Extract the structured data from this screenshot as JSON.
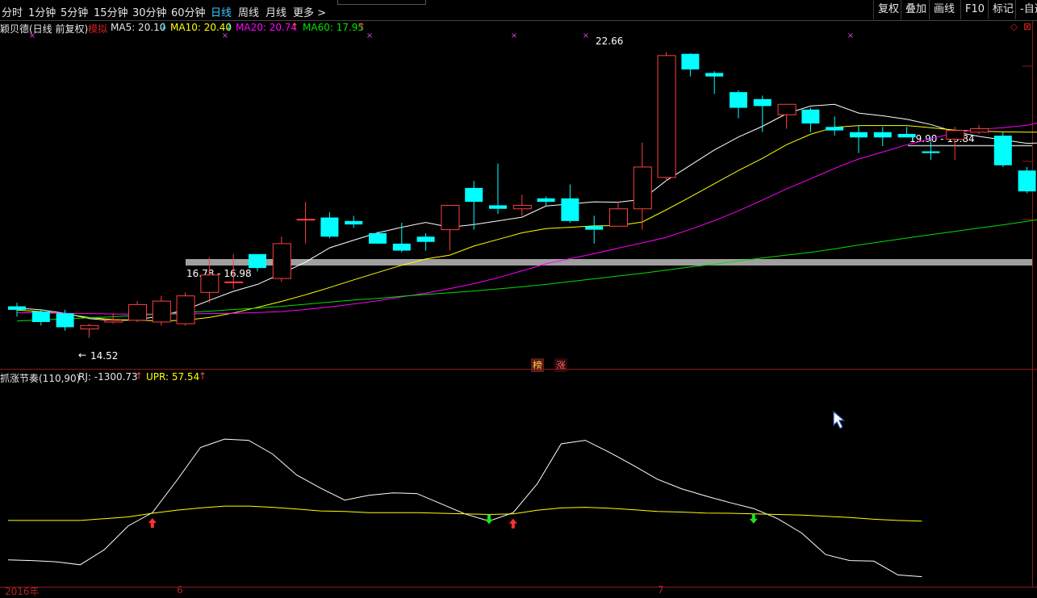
{
  "toolbar": {
    "timeframes": [
      "分时",
      "1分钟",
      "5分钟",
      "15分钟",
      "30分钟",
      "60分钟",
      "日线",
      "周线",
      "月线",
      "更多 >"
    ],
    "active": "日线",
    "right_buttons": [
      "复权",
      "叠加",
      "画线",
      "F10",
      "标记",
      "-自选"
    ]
  },
  "main_header": {
    "title": "颖贝德(日线 前复权)",
    "mode": "模拟",
    "ma5": "MA5: 20.10",
    "ma10": "MA10: 20.40",
    "ma20": "MA20: 20.74",
    "ma60": "MA60: 17.95"
  },
  "annotations": {
    "high": "22.66",
    "low": "14.52",
    "band1": "16.78 - 16.98",
    "band2": "19.90 - 19.84",
    "badge1": "榜",
    "badge2": "涨"
  },
  "sub_header": {
    "title": "抓涨节奏(110,90)",
    "rj": "RJ: -1300.73",
    "upr": "UPR: 57.54"
  },
  "xaxis": {
    "year": "2016年",
    "m1": "6",
    "m2": "7"
  },
  "colors": {
    "up": "#ff4040",
    "down": "#00ffff",
    "ma5": "#ffffff",
    "ma10": "#ffff00",
    "ma20": "#ff00ff",
    "ma60": "#00e000",
    "accent": "#3ec8ff"
  },
  "chart_data": [
    {
      "type": "candlestick",
      "ylim": [
        14.0,
        23.5
      ],
      "series": [
        {
          "name": "K线",
          "ohlc": [
            [
              15.4,
              15.5,
              15.1,
              15.3
            ],
            [
              15.25,
              15.3,
              14.85,
              14.95
            ],
            [
              15.2,
              15.3,
              14.7,
              14.8
            ],
            [
              14.75,
              14.9,
              14.5,
              14.85
            ],
            [
              14.95,
              15.2,
              14.9,
              15.0
            ],
            [
              15.0,
              15.55,
              14.95,
              15.45
            ],
            [
              14.95,
              15.7,
              14.85,
              15.55
            ],
            [
              14.9,
              15.8,
              14.85,
              15.7
            ],
            [
              15.8,
              16.8,
              15.5,
              16.3
            ],
            [
              16.1,
              16.9,
              15.9,
              16.1
            ],
            [
              16.9,
              16.9,
              16.4,
              16.5
            ],
            [
              16.2,
              17.4,
              16.1,
              17.2
            ],
            [
              17.9,
              18.4,
              17.2,
              17.9
            ],
            [
              17.95,
              18.1,
              17.35,
              17.4
            ],
            [
              17.85,
              18.0,
              17.65,
              17.75
            ],
            [
              17.5,
              17.55,
              17.2,
              17.2
            ],
            [
              17.2,
              17.8,
              16.95,
              17.0
            ],
            [
              17.4,
              17.5,
              17.0,
              17.25
            ],
            [
              17.6,
              18.3,
              17.0,
              18.3
            ],
            [
              18.8,
              19.0,
              17.6,
              18.4
            ],
            [
              18.3,
              19.5,
              18.05,
              18.2
            ],
            [
              18.2,
              18.6,
              18.0,
              18.3
            ],
            [
              18.5,
              18.55,
              18.3,
              18.4
            ],
            [
              18.5,
              18.9,
              17.8,
              17.85
            ],
            [
              17.7,
              18.0,
              17.2,
              17.6
            ],
            [
              17.7,
              18.4,
              17.7,
              18.2
            ],
            [
              18.2,
              20.1,
              17.6,
              19.4
            ],
            [
              19.1,
              22.7,
              19.0,
              22.6
            ],
            [
              22.65,
              22.66,
              22.0,
              22.2
            ],
            [
              22.1,
              22.15,
              21.5,
              22.0
            ],
            [
              21.55,
              21.6,
              20.8,
              21.1
            ],
            [
              21.35,
              21.45,
              20.4,
              21.15
            ],
            [
              20.9,
              21.1,
              20.5,
              21.2
            ],
            [
              21.05,
              21.1,
              20.4,
              20.65
            ],
            [
              20.55,
              20.85,
              20.3,
              20.45
            ],
            [
              20.4,
              20.6,
              19.8,
              20.25
            ],
            [
              20.4,
              20.55,
              20.0,
              20.25
            ],
            [
              20.35,
              20.55,
              20.25,
              20.25
            ],
            [
              19.85,
              20.2,
              19.6,
              19.8
            ],
            [
              20.2,
              20.55,
              19.6,
              20.45
            ],
            [
              20.4,
              20.6,
              20.35,
              20.5
            ],
            [
              20.3,
              20.4,
              19.4,
              19.45
            ],
            [
              19.3,
              19.4,
              18.65,
              18.7
            ],
            [
              18.7,
              19.35,
              18.65,
              19.3
            ]
          ]
        },
        {
          "name": "MA5",
          "values": [
            15.35,
            15.3,
            15.2,
            15.05,
            14.99,
            15.01,
            15.13,
            15.3,
            15.57,
            15.83,
            16.03,
            16.34,
            16.67,
            17.08,
            17.3,
            17.51,
            17.67,
            17.81,
            17.67,
            17.75,
            17.85,
            17.96,
            18.28,
            18.34,
            18.4,
            18.39,
            18.47,
            19.01,
            19.45,
            19.89,
            20.26,
            20.57,
            20.93,
            21.15,
            21.2,
            20.95,
            20.87,
            20.77,
            20.62,
            20.41,
            20.28,
            20.18,
            20.08,
            20.1
          ]
        },
        {
          "name": "MA10",
          "values": [
            15.29,
            15.25,
            15.18,
            15.08,
            15.02,
            15.0,
            14.98,
            15.0,
            15.08,
            15.21,
            15.37,
            15.54,
            15.73,
            15.94,
            16.16,
            16.37,
            16.58,
            16.76,
            16.87,
            17.13,
            17.32,
            17.51,
            17.63,
            17.67,
            17.71,
            17.72,
            17.82,
            18.17,
            18.54,
            18.92,
            19.3,
            19.65,
            20.04,
            20.34,
            20.54,
            20.59,
            20.59,
            20.59,
            20.53,
            20.46,
            20.43,
            20.41,
            20.4,
            20.4
          ]
        },
        {
          "name": "MA20",
          "values": [
            15.22,
            15.21,
            15.2,
            15.19,
            15.18,
            15.18,
            15.18,
            15.18,
            15.19,
            15.2,
            15.22,
            15.25,
            15.31,
            15.38,
            15.47,
            15.56,
            15.67,
            15.78,
            15.91,
            16.05,
            16.22,
            16.42,
            16.62,
            16.77,
            16.91,
            17.07,
            17.22,
            17.38,
            17.61,
            17.86,
            18.14,
            18.45,
            18.77,
            19.06,
            19.36,
            19.63,
            19.83,
            20.04,
            20.21,
            20.38,
            20.48,
            20.53,
            20.6,
            20.74
          ]
        },
        {
          "name": "MA60",
          "values": [
            14.98,
            15.01,
            15.04,
            15.07,
            15.1,
            15.14,
            15.18,
            15.22,
            15.26,
            15.31,
            15.35,
            15.4,
            15.46,
            15.52,
            15.58,
            15.63,
            15.69,
            15.74,
            15.79,
            15.84,
            15.9,
            15.96,
            16.03,
            16.11,
            16.19,
            16.27,
            16.35,
            16.44,
            16.53,
            16.61,
            16.7,
            16.79,
            16.87,
            16.95,
            17.05,
            17.16,
            17.26,
            17.36,
            17.46,
            17.55,
            17.65,
            17.74,
            17.84,
            17.95
          ]
        }
      ]
    },
    {
      "type": "line",
      "ylim": [
        -1400,
        2000
      ],
      "series": [
        {
          "name": "RJ",
          "values": [
            -1020,
            -1030,
            -1050,
            -1100,
            -850,
            -450,
            -230,
            300,
            860,
            1000,
            980,
            750,
            400,
            180,
            -20,
            60,
            100,
            90,
            -80,
            -250,
            -370,
            -230,
            250,
            920,
            980,
            780,
            560,
            330,
            170,
            50,
            -60,
            -160,
            -330,
            -570,
            -930,
            -1030,
            -1040,
            -1270,
            -1300
          ]
        },
        {
          "name": "UPR",
          "values": [
            -360,
            -360,
            -360,
            -360,
            -330,
            -300,
            -240,
            -190,
            -150,
            -120,
            -120,
            -140,
            -170,
            -200,
            -210,
            -230,
            -230,
            -230,
            -240,
            -250,
            -260,
            -250,
            -190,
            -150,
            -140,
            -155,
            -180,
            -210,
            -220,
            -235,
            -240,
            -250,
            -260,
            -270,
            -290,
            -310,
            -340,
            -360,
            -370
          ]
        }
      ],
      "signals": [
        {
          "type": "buy",
          "index": 6
        },
        {
          "type": "sell",
          "index": 20
        },
        {
          "type": "buy",
          "index": 21
        },
        {
          "type": "sell",
          "index": 31
        }
      ]
    }
  ]
}
